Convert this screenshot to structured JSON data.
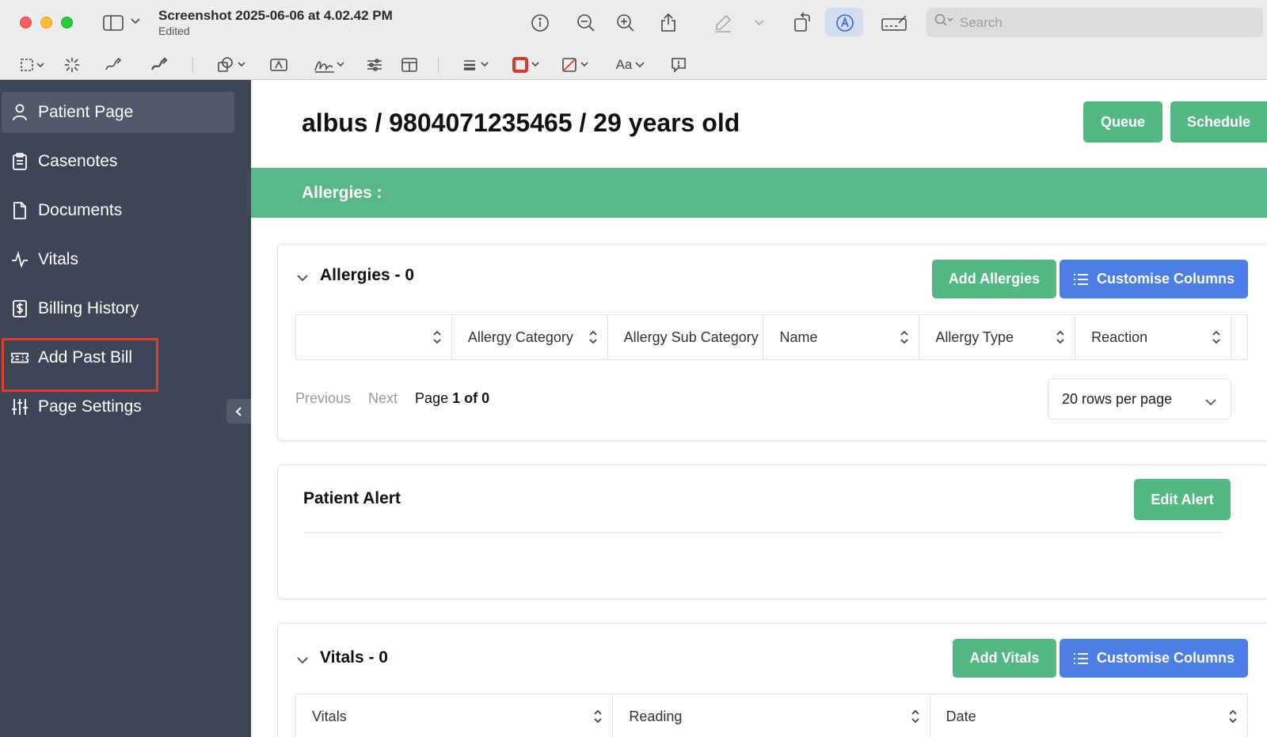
{
  "window": {
    "title": "Screenshot 2025-06-06 at 4.02.42 PM",
    "subtitle": "Edited",
    "search_placeholder": "Search",
    "font_label": "Aa"
  },
  "sidebar": {
    "items": [
      {
        "label": "Patient Page",
        "icon": "user-icon",
        "active": true
      },
      {
        "label": "Casenotes",
        "icon": "clipboard-icon"
      },
      {
        "label": "Documents",
        "icon": "document-icon"
      },
      {
        "label": "Vitals",
        "icon": "activity-icon"
      },
      {
        "label": "Billing History",
        "icon": "billing-icon"
      },
      {
        "label": "Add Past Bill",
        "icon": "ticket-icon",
        "highlighted": true
      },
      {
        "label": "Page Settings",
        "icon": "sliders-icon"
      }
    ]
  },
  "header": {
    "patient_title": "albus / 9804071235465 / 29 years old",
    "queue_label": "Queue",
    "schedule_label": "Schedule"
  },
  "allergy_banner": {
    "label": "Allergies :"
  },
  "allergies_card": {
    "title": "Allergies - 0",
    "add_label": "Add Allergies",
    "customise_label": "Customise Columns",
    "columns": [
      "",
      "Allergy Category",
      "Allergy Sub Category",
      "Name",
      "Allergy Type",
      "Reaction"
    ],
    "pagination": {
      "previous": "Previous",
      "next": "Next",
      "page_prefix": "Page",
      "page_current": "1",
      "page_of": "of",
      "page_total": "0",
      "rows_per_page": "20 rows per page"
    }
  },
  "alert_card": {
    "title": "Patient Alert",
    "edit_label": "Edit Alert"
  },
  "vitals_card": {
    "title": "Vitals - 0",
    "add_label": "Add Vitals",
    "customise_label": "Customise Columns",
    "columns": [
      "Vitals",
      "Reading",
      "Date"
    ]
  },
  "colors": {
    "sidebar_bg": "#3d4556",
    "sidebar_active": "#515a6b",
    "green": "#54b883",
    "blue": "#4c7ee8",
    "highlight": "#e0402a"
  }
}
